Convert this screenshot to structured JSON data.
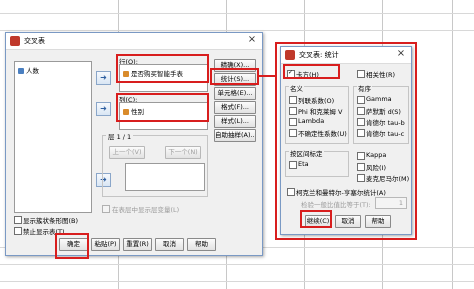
{
  "main_dialog": {
    "title": "交叉表",
    "source_variable": "人数",
    "row_label": "行(O):",
    "row_variable": "是否购买智能手表",
    "column_label": "列(C):",
    "column_variable": "性别",
    "layer_label": "层 1 / 1",
    "prev_button": "上一个(V)",
    "next_button": "下一个(N)",
    "layer_checkbox": "在表层中显示层变量(L)",
    "side_buttons": [
      "精确(X)...",
      "统计(S)...",
      "单元格(E)...",
      "格式(F)...",
      "样式(L)...",
      "自助抽样(A)..."
    ],
    "show_clustered_bar": "显示簇状条形图(B)",
    "suppress_tables": "禁止显示表(T)",
    "bottom_buttons": [
      "确定",
      "粘贴(P)",
      "重置(R)",
      "取消",
      "帮助"
    ]
  },
  "stats_dialog": {
    "title": "交叉表: 统计",
    "chi_square": "卡方(H)",
    "correlations": "相关性(R)",
    "nominal_label": "名义",
    "nominal_items": [
      "列联系数(O)",
      "Phi 和克莱姆 V",
      "Lambda",
      "不确定性系数(U)"
    ],
    "ordinal_label": "有序",
    "ordinal_items": [
      "Gamma",
      "萨默斯 d(S)",
      "肯德尔 tau-b",
      "肯德尔 tau-c"
    ],
    "interval_label": "按区间标定",
    "eta": "Eta",
    "kappa": "Kappa",
    "risk": "风险(I)",
    "mcnemar": "麦克尼马尔(M)",
    "cmh": "柯克兰和曼特尔-亨塞尔统计(A)",
    "common_odds": "检验一般比值比等于(T):",
    "common_odds_value": "1",
    "buttons": [
      "继续(C)",
      "取消",
      "帮助"
    ]
  }
}
